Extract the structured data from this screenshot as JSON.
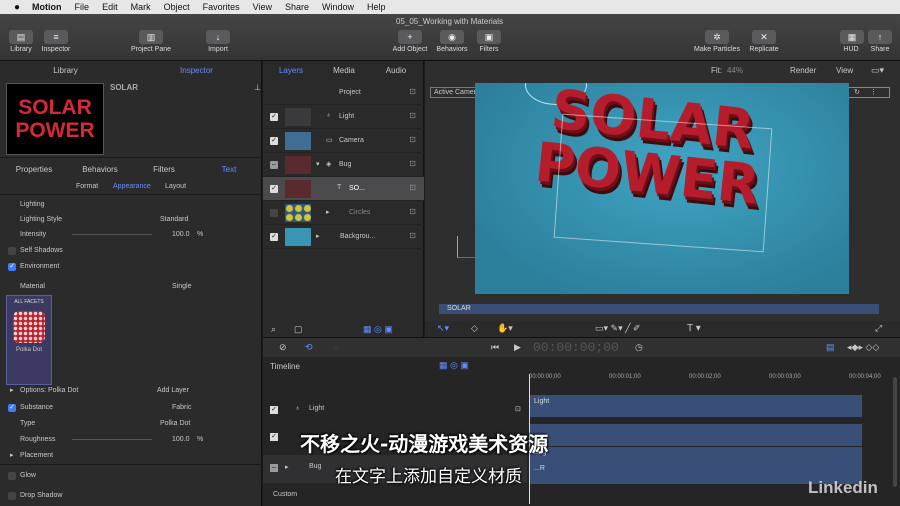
{
  "menubar": {
    "apple": "",
    "app": "Motion",
    "items": [
      "File",
      "Edit",
      "Mark",
      "Object",
      "Favorites",
      "View",
      "Share",
      "Window",
      "Help"
    ]
  },
  "window": {
    "title": "05_05_Working with Materials"
  },
  "toolbar": {
    "library": "Library",
    "inspector": "Inspector",
    "project_pane": "Project Pane",
    "import": "Import",
    "add_object": "Add Object",
    "behaviors": "Behaviors",
    "filters": "Filters",
    "make_particles": "Make Particles",
    "replicate": "Replicate",
    "hud": "HUD",
    "share": "Share"
  },
  "inspector": {
    "tabs": [
      "Library",
      "Inspector"
    ],
    "preview_name": "SOLAR",
    "preview_text": "SOLAR POWER",
    "subtabs": [
      "Properties",
      "Behaviors",
      "Filters",
      "Text"
    ],
    "subsubtabs": [
      "Format",
      "Appearance",
      "Layout"
    ],
    "lighting_header": "Lighting",
    "lighting_style_label": "Lighting Style",
    "lighting_style_value": "Standard",
    "intensity_label": "Intensity",
    "intensity_value": "100.0",
    "intensity_unit": "%",
    "self_shadows": "Self Shadows",
    "environment": "Environment",
    "material_label": "Material",
    "material_value": "Single",
    "all_facets": "ALL FACETS",
    "material_name": "Polka Dot",
    "options_label": "Options: Polka Dot",
    "add_layer": "Add Layer",
    "substance_label": "Substance",
    "substance_value": "Fabric",
    "type_label": "Type",
    "type_value": "Polka Dot",
    "roughness_label": "Roughness",
    "roughness_value": "100.0",
    "roughness_unit": "%",
    "placement_label": "Placement",
    "glow_label": "Glow",
    "drop_shadow_label": "Drop Shadow"
  },
  "layers": {
    "tabs": [
      "Layers",
      "Media",
      "Audio"
    ],
    "rows": [
      {
        "name": "Project"
      },
      {
        "name": "Light"
      },
      {
        "name": "Camera"
      },
      {
        "name": "Bug"
      },
      {
        "name": "SO..."
      },
      {
        "name": "Circles"
      },
      {
        "name": "Backgrou..."
      }
    ]
  },
  "canvas": {
    "fit_label": "Fit:",
    "fit_value": "44%",
    "render": "Render",
    "view": "View",
    "camera": "Active Camera",
    "text": "SOLAR POWER",
    "bar_label": "SOLAR",
    "timecode": "00:00:00;00"
  },
  "timeline": {
    "label": "Timeline",
    "rows": [
      {
        "name": "Light"
      },
      {
        "name": "Bug"
      }
    ],
    "ticks": [
      "00:00:00;00",
      "00:00:01;00",
      "00:00:02;00",
      "00:00:03;00",
      "00:00:04;00"
    ],
    "bars": [
      "Light",
      "Bug",
      "...R"
    ],
    "custom": "Custom"
  },
  "overlay": {
    "subtitle1": "不移之火-动漫游戏美术资源",
    "subtitle2": "在文字上添加自定义材质",
    "watermark": "Linkedin"
  }
}
